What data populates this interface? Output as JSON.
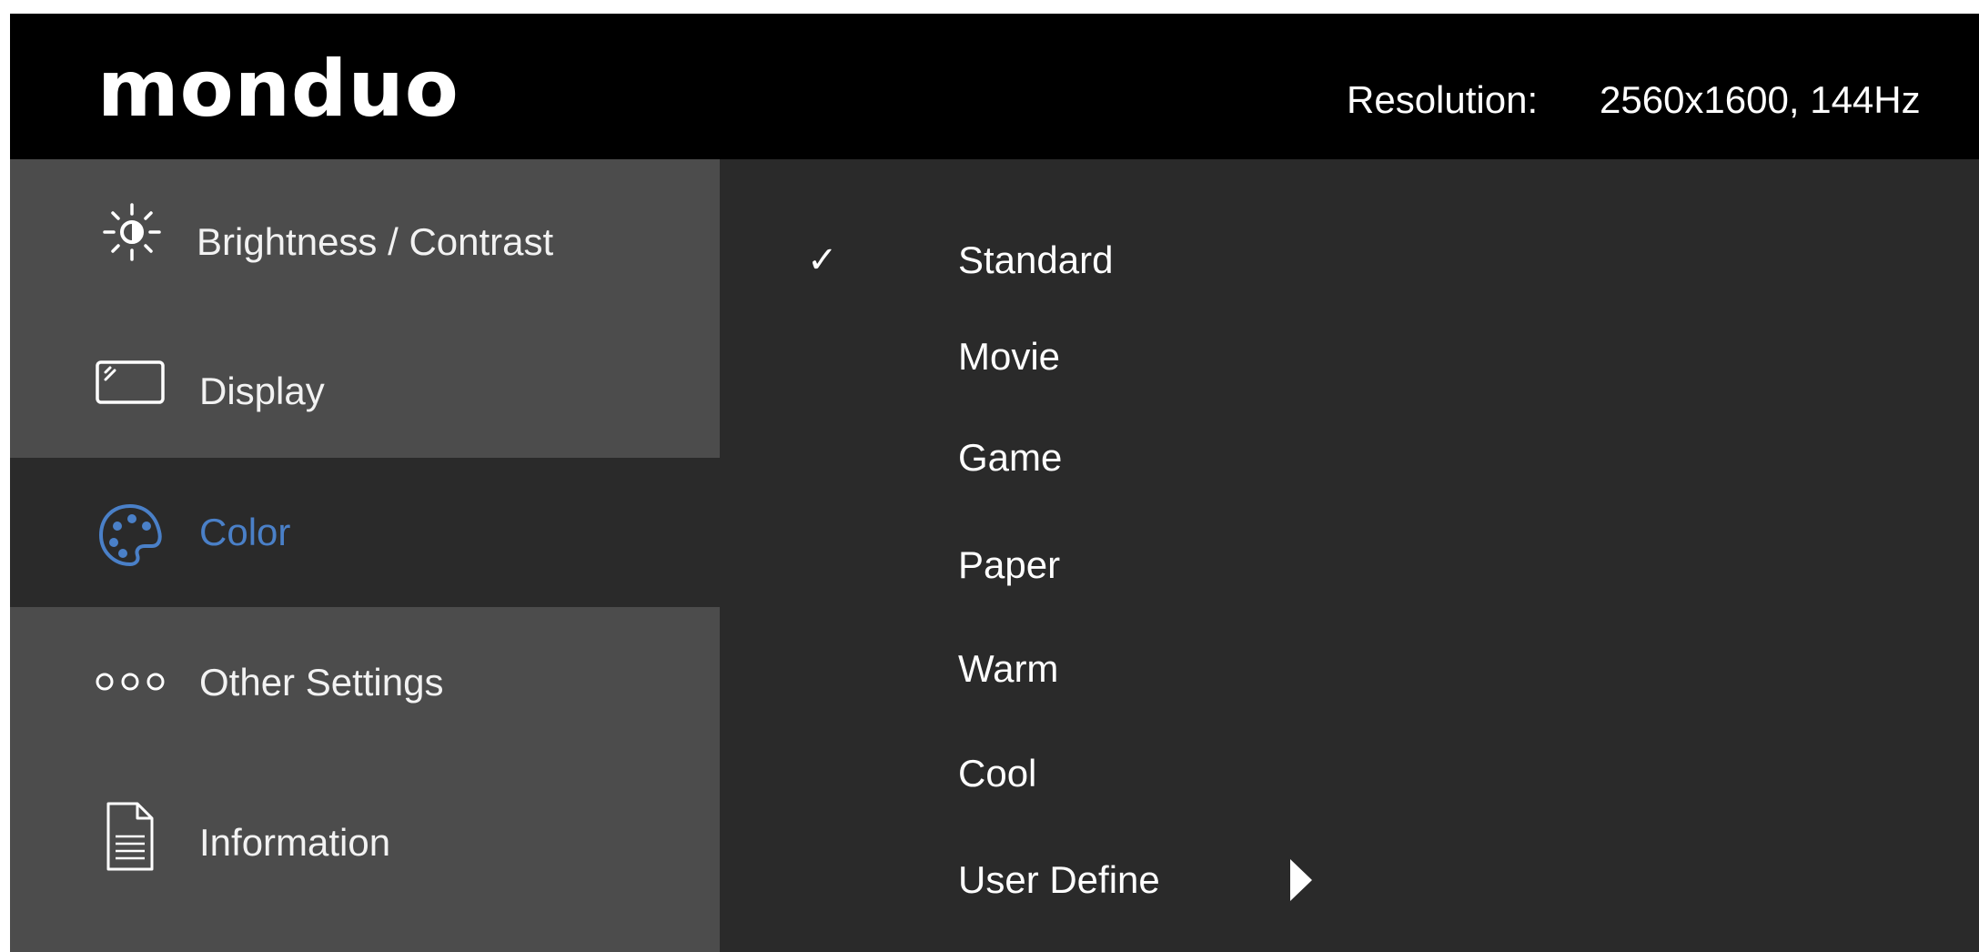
{
  "header": {
    "logo": "monduo",
    "logo_mark": "®",
    "resolution_label": "Resolution:",
    "resolution_value": "2560x1600, 144Hz"
  },
  "sidebar": {
    "items": [
      {
        "label": "Brightness / Contrast",
        "icon": "brightness-icon",
        "active": false
      },
      {
        "label": "Display",
        "icon": "display-icon",
        "active": false
      },
      {
        "label": "Color",
        "icon": "palette-icon",
        "active": true
      },
      {
        "label": "Other Settings",
        "icon": "dots-icon",
        "active": false
      },
      {
        "label": "Information",
        "icon": "document-icon",
        "active": false
      }
    ]
  },
  "options": {
    "check_glyph": "✓",
    "items": [
      {
        "label": "Standard",
        "selected": true
      },
      {
        "label": "Movie",
        "selected": false
      },
      {
        "label": "Game",
        "selected": false
      },
      {
        "label": "Paper",
        "selected": false
      },
      {
        "label": "Warm",
        "selected": false
      },
      {
        "label": "Cool",
        "selected": false
      },
      {
        "label": "User Define",
        "selected": false,
        "has_submenu": true
      }
    ]
  },
  "colors": {
    "header_bg": "#000000",
    "sidebar_bg": "#4c4c4c",
    "active_bg": "#2a2a2a",
    "accent": "#4a80c8",
    "text": "#ffffff"
  }
}
